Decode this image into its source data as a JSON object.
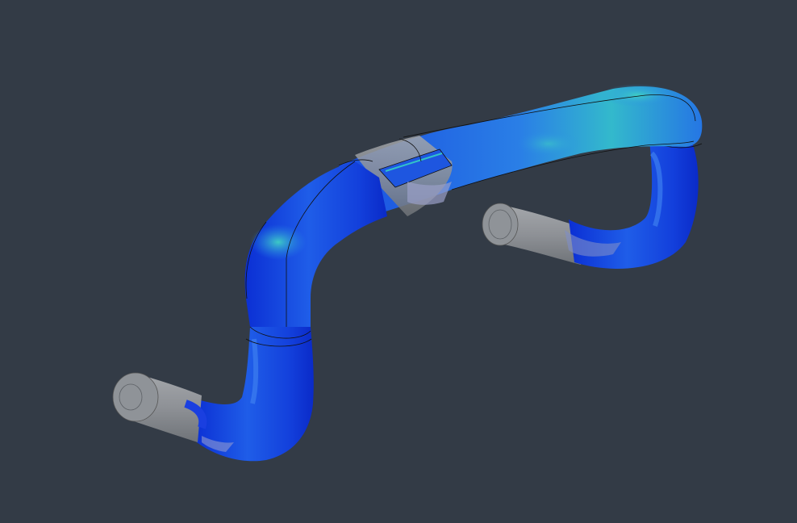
{
  "viewport": {
    "background": "#333b46",
    "model": "bicycle-drop-handlebar",
    "render_mode": "stress-contour",
    "colors": {
      "deep_blue": "#0a2fd6",
      "mid_blue": "#1f63e8",
      "light_blue": "#2f8ee8",
      "cyan": "#33c2c8",
      "grip_grey": "#8c9096",
      "grip_grey_light": "#a8abaf",
      "edge_line": "#101010"
    }
  }
}
